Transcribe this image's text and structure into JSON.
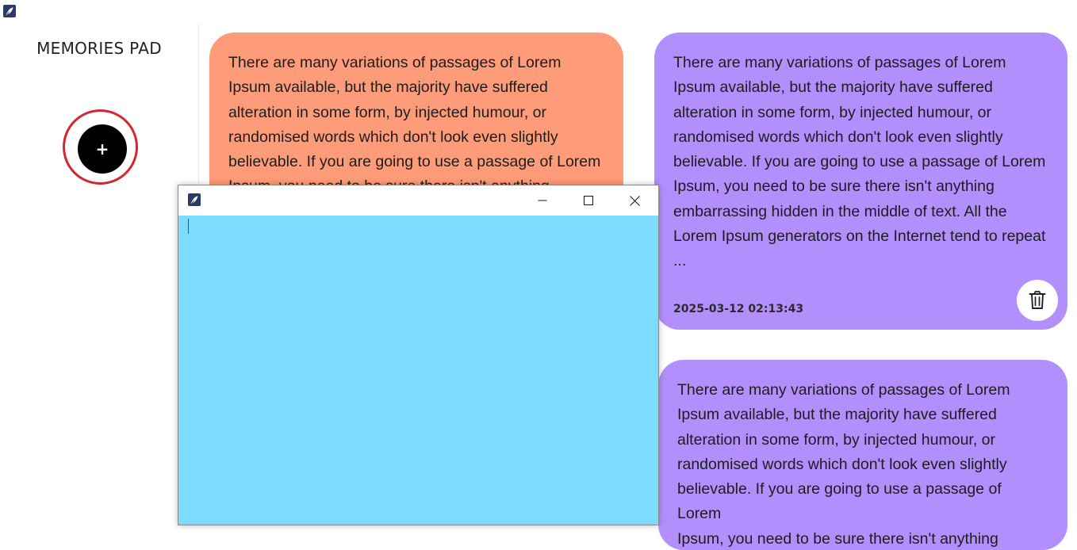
{
  "app": {
    "title": "MEMORIES PAD",
    "icon": "feather-pen-icon",
    "add_button_label": "+"
  },
  "notes": [
    {
      "color": "#fe9b78",
      "text": "There are many variations of passages of Lorem\nIpsum available, but the majority have suffered\nalteration in some form, by injected humour, or\nrandomised words which don't look even slightly\nbelievable. If you are going to use a passage of Lorem\nIpsum, you need to be sure there isn't anything",
      "timestamp": ""
    },
    {
      "color": "#b38efd",
      "text": "There are many variations of passages of Lorem\nIpsum available, but the majority have suffered\nalteration in some form, by injected humour, or\nrandomised words which don't look even slightly\nbelievable. If you are going to use a passage of Lorem\nIpsum, you need to be sure there isn't anything\nembarrassing hidden in the middle of text. All the\nLorem Ipsum generators on the Internet tend to repeat\n...",
      "timestamp": "2025-03-12 02:13:43",
      "delete_icon": "trash-icon"
    },
    {
      "color": "#b38efd",
      "text": "There are many variations of passages of Lorem\nIpsum available, but the majority have suffered\nalteration in some form, by injected humour, or\nrandomised words which don't look even slightly\nbelievable. If you are going to use a passage of Lorem\nIpsum, you need to be sure there isn't anything",
      "timestamp": ""
    }
  ],
  "editor_window": {
    "icon": "feather-pen-icon",
    "background": "#7ddcfd",
    "content": "",
    "controls": [
      "minimize-icon",
      "maximize-icon",
      "close-icon"
    ]
  }
}
